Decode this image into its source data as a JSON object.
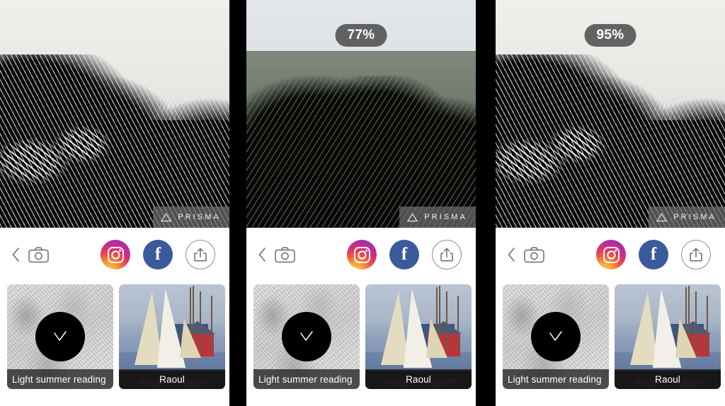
{
  "app": {
    "name": "Prisma",
    "watermark_text": "PRISMA",
    "watermark_icon": "triangle-outline-icon"
  },
  "panels": [
    {
      "id": "panel-1",
      "filter_percent_label": "",
      "filter_percent_value": 100,
      "show_percent_badge": false,
      "photo_description": "black-and-white etched sketch of bamboo foliage and hatched hillside",
      "photo_tinted": false
    },
    {
      "id": "panel-2",
      "filter_percent_label": "77%",
      "filter_percent_value": 77,
      "show_percent_badge": true,
      "photo_description": "partially filtered photo with green olive foliage tint",
      "photo_tinted": true
    },
    {
      "id": "panel-3",
      "filter_percent_label": "95%",
      "filter_percent_value": 95,
      "show_percent_badge": true,
      "photo_description": "black-and-white etched sketch of bamboo foliage and hatched hillside",
      "photo_tinted": false
    }
  ],
  "toolbar": {
    "back_icon": "chevron-left-icon",
    "camera_icon": "camera-icon",
    "instagram_label": "Instagram",
    "instagram_icon": "instagram-icon",
    "facebook_label": "f",
    "facebook_icon": "facebook-icon",
    "share_label": "Share",
    "share_icon": "share-upload-icon"
  },
  "styles": {
    "items": [
      {
        "name": "Light summer reading",
        "selected": true,
        "art": "sketch",
        "check_icon": "checkmark-icon"
      },
      {
        "name": "Raoul",
        "selected": false,
        "art": "harbour",
        "check_icon": "checkmark-icon"
      }
    ]
  },
  "colors": {
    "facebook_blue": "#3b5a9b",
    "badge_background": "rgba(60,60,60,0.78)",
    "watermark_background": "rgba(110,110,110,0.72)",
    "selection_badge": "#000000",
    "panel_background": "#ffffff",
    "gutter": "#000000"
  }
}
